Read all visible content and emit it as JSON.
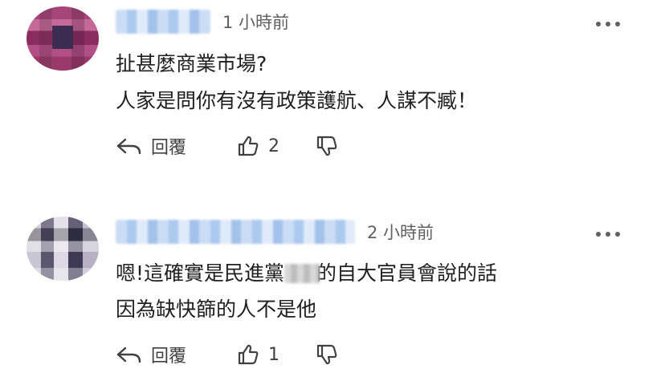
{
  "comments": [
    {
      "timestamp": "1 小時前",
      "lines": [
        "扯甚麼商業市場?",
        "人家是問你有沒有政策護航、人謀不臧！"
      ],
      "reply_label": "回覆",
      "like_count": "2"
    },
    {
      "timestamp": "2 小時前",
      "line1_before": "嗯!這確實是民進黨",
      "line1_after": "的自大官員會說的話",
      "line2": "因為缺快篩的人不是他",
      "reply_label": "回覆",
      "like_count": "1"
    }
  ],
  "icons": {
    "reply": "reply-arrow-icon",
    "like": "thumbs-up-icon",
    "dislike": "thumbs-down-icon",
    "more": "more-vertical-icon"
  }
}
